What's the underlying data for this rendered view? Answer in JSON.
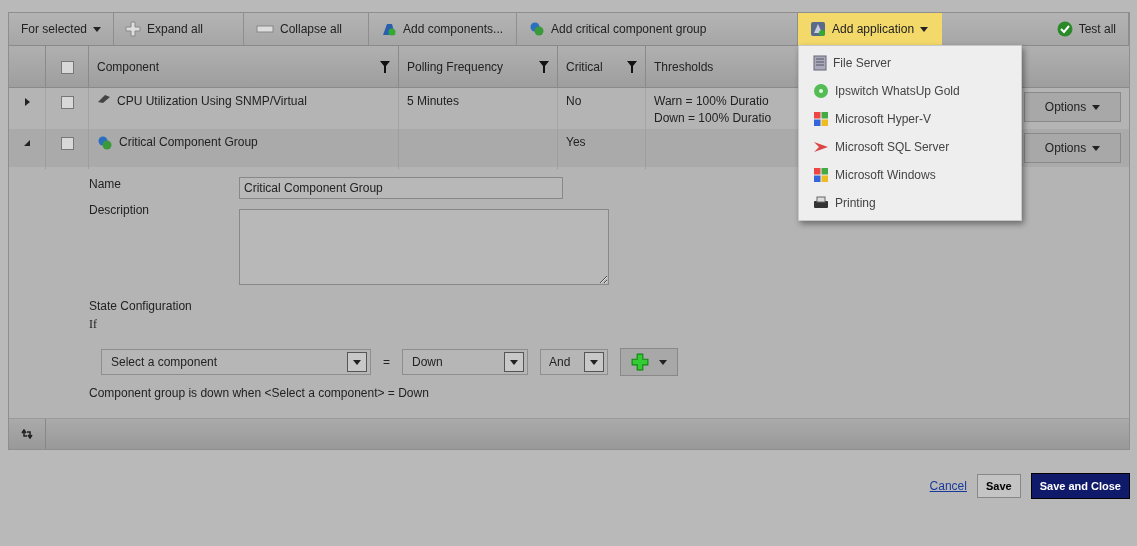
{
  "toolbar": [
    {
      "kind": "dropdown",
      "label": "For selected",
      "expanded": false
    },
    {
      "kind": "button",
      "label": "Expand all"
    },
    {
      "kind": "button",
      "label": "Collapse all"
    },
    {
      "kind": "button",
      "label": "Add components..."
    },
    {
      "kind": "button",
      "label": "Add critical component group"
    },
    {
      "kind": "dropdown",
      "label": "Add application",
      "expanded": true
    },
    {
      "kind": "spacer"
    },
    {
      "kind": "button",
      "label": "Test all"
    }
  ],
  "application_menu": [
    "File Server",
    "Ipswitch WhatsUp Gold",
    "Microsoft Hyper-V",
    "Microsoft SQL Server",
    "Microsoft Windows",
    "Printing"
  ],
  "table": {
    "columns": [
      {
        "label": "Component",
        "filter": true
      },
      {
        "label": "Polling Frequency",
        "filter": true
      },
      {
        "label": "Critical",
        "filter": true
      },
      {
        "label": "Thresholds",
        "filter": false
      }
    ],
    "header_checked": false,
    "rows": [
      {
        "expanded": false,
        "checked": false,
        "component": "CPU Utilization Using SNMP/Virtual",
        "polling": "5 Minutes",
        "critical": "No",
        "thresholds": [
          "Warn = 100% Duratio",
          "Down = 100% Duratio"
        ],
        "options": "Options"
      },
      {
        "expanded": true,
        "checked": false,
        "component": "Critical Component Group",
        "polling": "",
        "critical": "Yes",
        "thresholds": [],
        "options": "Options"
      }
    ]
  },
  "detail": {
    "name_label": "Name",
    "name_value": "Critical Component Group",
    "description_label": "Description",
    "state_label": "State Configuration",
    "if_label": "If",
    "condition": {
      "component": "Select a component",
      "operator": "=",
      "state": "Down",
      "joiner": "And"
    },
    "summary": "Component group is down when <Select a component> = Down"
  },
  "footer": {
    "cancel": "Cancel",
    "save": "Save",
    "save_close": "Save and Close"
  }
}
